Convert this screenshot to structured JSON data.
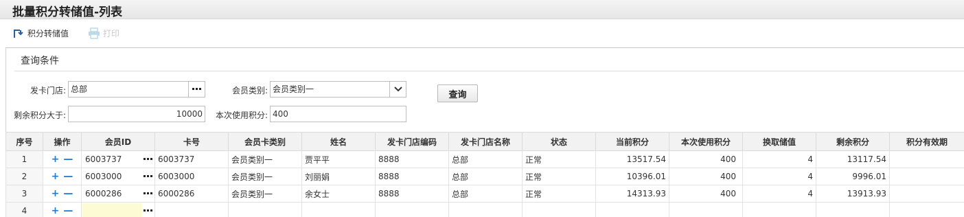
{
  "title": "批量积分转储值-列表",
  "toolbar": {
    "convert_label": "积分转储值",
    "print_label": "打印"
  },
  "query": {
    "section_title": "查询条件",
    "store_label": "发卡门店:",
    "store_value": "总部",
    "member_type_label": "会员类别:",
    "member_type_value": "会员类别一",
    "remaining_label": "剩余积分大于:",
    "remaining_value": "10000",
    "use_label": "本次使用积分:",
    "use_value": "400",
    "search_button": "查询"
  },
  "grid": {
    "columns": [
      "序号",
      "操作",
      "会员ID",
      "卡号",
      "会员卡类别",
      "姓名",
      "发卡门店编码",
      "发卡门店名称",
      "状态",
      "当前积分",
      "本次使用积分",
      "换取储值",
      "剩余积分",
      "积分有效期"
    ],
    "rows": [
      {
        "idx": "1",
        "member_id": "6003737",
        "card_no": "6003737",
        "card_type": "会员类别一",
        "name": "贾平平",
        "store_code": "8888",
        "store_name": "总部",
        "status": "正常",
        "current": "13517.54",
        "use": "400",
        "exchange": "4",
        "remaining": "13117.54",
        "expiry": ""
      },
      {
        "idx": "2",
        "member_id": "6003000",
        "card_no": "6003000",
        "card_type": "会员类别一",
        "name": "刘丽娟",
        "store_code": "8888",
        "store_name": "总部",
        "status": "正常",
        "current": "10396.01",
        "use": "400",
        "exchange": "4",
        "remaining": "9996.01",
        "expiry": ""
      },
      {
        "idx": "3",
        "member_id": "6000286",
        "card_no": "6000286",
        "card_type": "会员类别一",
        "name": "余女士",
        "store_code": "8888",
        "store_name": "总部",
        "status": "正常",
        "current": "14313.93",
        "use": "400",
        "exchange": "4",
        "remaining": "13913.93",
        "expiry": ""
      },
      {
        "idx": "4",
        "member_id": "",
        "card_no": "",
        "card_type": "",
        "name": "",
        "store_code": "",
        "store_name": "",
        "status": "",
        "current": "",
        "use": "",
        "exchange": "",
        "remaining": "",
        "expiry": ""
      }
    ]
  },
  "colors": {
    "accent": "#1f7bd1",
    "empty_input": "#fdfbd4",
    "header_bg": "#f2f2f2"
  }
}
